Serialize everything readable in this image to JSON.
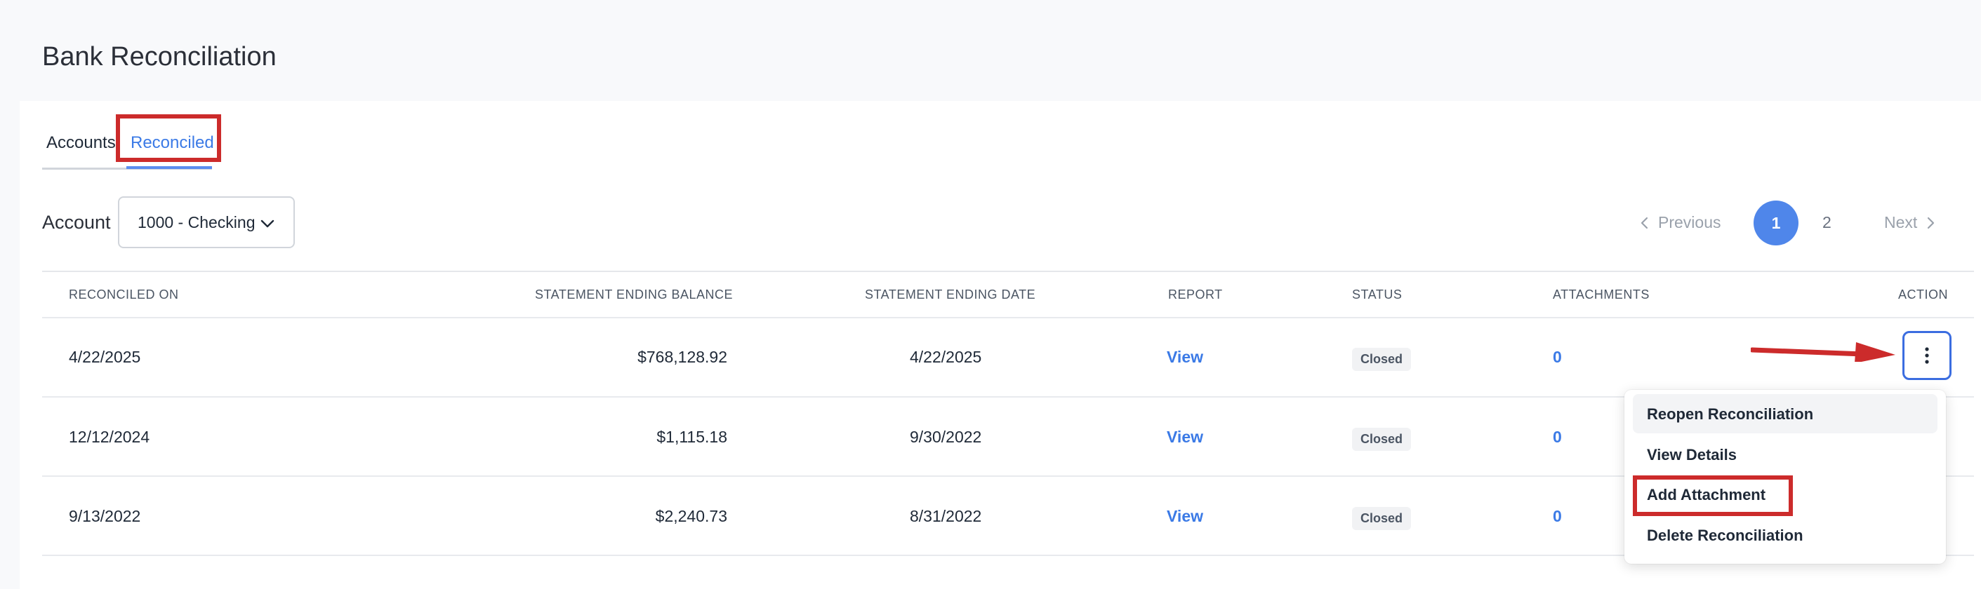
{
  "page": {
    "title": "Bank Reconciliation"
  },
  "tabs": {
    "accounts": "Accounts",
    "reconciled": "Reconciled"
  },
  "filter": {
    "label": "Account",
    "selected": "1000 - Checking"
  },
  "pagination": {
    "previous": "Previous",
    "page1": "1",
    "page2": "2",
    "next": "Next"
  },
  "table": {
    "headers": [
      "RECONCILED ON",
      "STATEMENT ENDING BALANCE",
      "STATEMENT ENDING DATE",
      "REPORT",
      "STATUS",
      "ATTACHMENTS",
      "ACTION"
    ],
    "rows": [
      {
        "reconciled_on": "4/22/2025",
        "balance": "$768,128.92",
        "ending_date": "4/22/2025",
        "report": "View",
        "status": "Closed",
        "attachments": "0"
      },
      {
        "reconciled_on": "12/12/2024",
        "balance": "$1,115.18",
        "ending_date": "9/30/2022",
        "report": "View",
        "status": "Closed",
        "attachments": "0"
      },
      {
        "reconciled_on": "9/13/2022",
        "balance": "$2,240.73",
        "ending_date": "8/31/2022",
        "report": "View",
        "status": "Closed",
        "attachments": "0"
      }
    ]
  },
  "action_menu": {
    "items": [
      "Reopen Reconciliation",
      "View Details",
      "Add Attachment",
      "Delete Reconciliation"
    ]
  },
  "colors": {
    "accent": "#3b7ae6",
    "highlight": "#cc2b2b"
  }
}
